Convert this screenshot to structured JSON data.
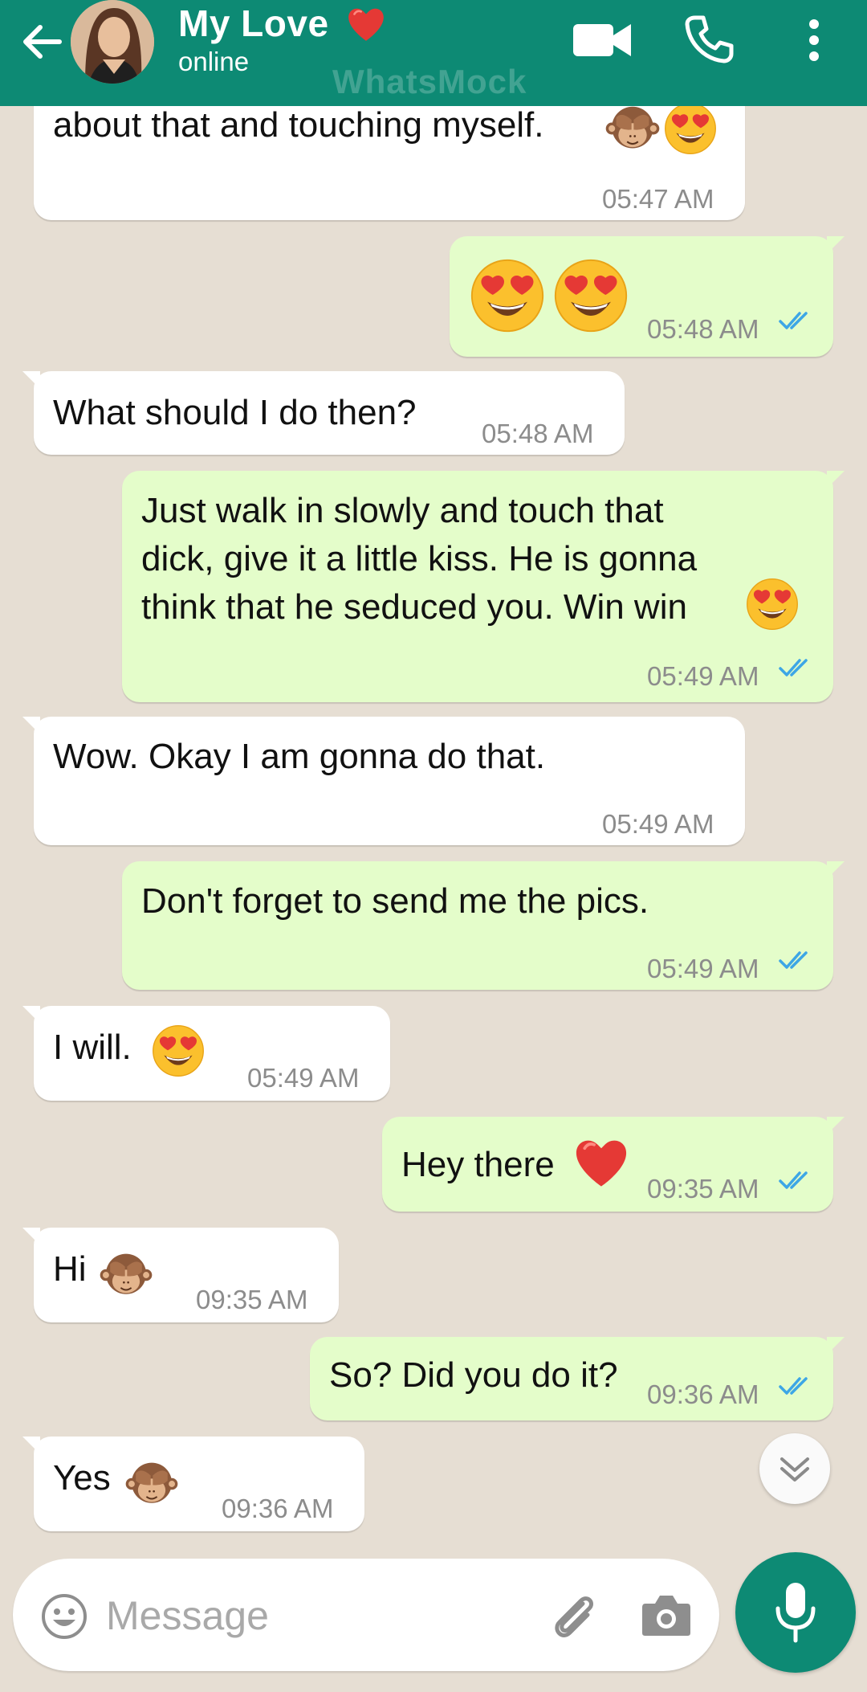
{
  "header": {
    "contact_name": "My Love",
    "status": "online",
    "watermark": "WhatsMock"
  },
  "messages": [
    {
      "direction": "incoming",
      "text": "about that and touching myself.",
      "time": "05:47 AM",
      "emojis": [
        "see-no-evil-monkey",
        "heart-eyes"
      ]
    },
    {
      "direction": "outgoing",
      "text": "",
      "time": "05:48 AM",
      "emojis": [
        "heart-eyes",
        "heart-eyes"
      ],
      "status": "read"
    },
    {
      "direction": "incoming",
      "text": "What should I do then?",
      "time": "05:48 AM"
    },
    {
      "direction": "outgoing",
      "text": "Just walk in slowly and touch that\ndick, give it a little kiss. He is gonna\nthink that he seduced you. Win win",
      "time": "05:49 AM",
      "emojis": [
        "heart-eyes"
      ],
      "status": "read"
    },
    {
      "direction": "incoming",
      "text": "Wow. Okay I am gonna do that.",
      "time": "05:49 AM"
    },
    {
      "direction": "outgoing",
      "text": "Don't forget to send me the pics.",
      "time": "05:49 AM",
      "status": "read"
    },
    {
      "direction": "incoming",
      "text": "I will.",
      "time": "05:49 AM",
      "emojis": [
        "heart-eyes"
      ]
    },
    {
      "direction": "outgoing",
      "text": "Hey there",
      "time": "09:35 AM",
      "emojis": [
        "red-heart"
      ],
      "status": "read"
    },
    {
      "direction": "incoming",
      "text": "Hi",
      "time": "09:35 AM",
      "emojis": [
        "see-no-evil-monkey"
      ]
    },
    {
      "direction": "outgoing",
      "text": "So? Did you do it?",
      "time": "09:36 AM",
      "status": "read"
    },
    {
      "direction": "incoming",
      "text": "Yes",
      "time": "09:36 AM",
      "emojis": [
        "see-no-evil-monkey"
      ]
    }
  ],
  "composer": {
    "placeholder": "Message"
  },
  "colors": {
    "header": "#0d8a74",
    "outgoing_bubble": "#e4fdca",
    "incoming_bubble": "#ffffff",
    "chat_background": "#e6ded3",
    "read_ticks": "#3da6e6"
  }
}
